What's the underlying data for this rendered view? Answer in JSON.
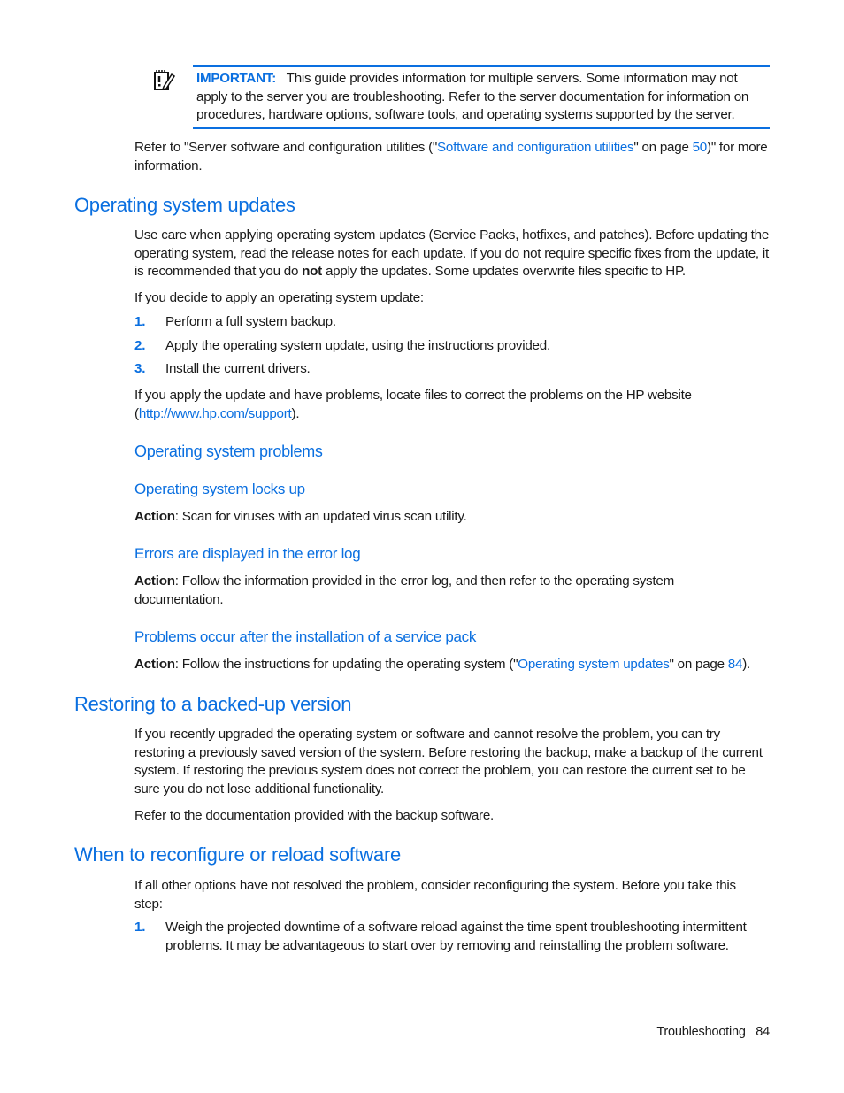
{
  "note": {
    "icon": "notepad-pencil-icon",
    "label": "IMPORTANT:",
    "text": "This guide provides information for multiple servers. Some information may not apply to the server you are troubleshooting. Refer to the server documentation for information on procedures, hardware options, software tools, and operating systems supported by the server."
  },
  "refer_para": {
    "pre": "Refer to \"Server software and configuration utilities (\"",
    "link": "Software and configuration utilities",
    "mid": "\" on page ",
    "page_link": "50",
    "post": ")\" for more information."
  },
  "section_os_updates": {
    "heading": "Operating system updates",
    "para1_pre": "Use care when applying operating system updates (Service Packs, hotfixes, and patches). Before updating the operating system, read the release notes for each update. If you do not require specific fixes from the update, it is recommended that you do ",
    "para1_bold": "not",
    "para1_post": " apply the updates. Some updates overwrite files specific to HP.",
    "para2": "If you decide to apply an operating system update:",
    "steps": [
      {
        "num": "1.",
        "text": "Perform a full system backup."
      },
      {
        "num": "2.",
        "text": "Apply the operating system update, using the instructions provided."
      },
      {
        "num": "3.",
        "text": "Install the current drivers."
      }
    ],
    "para3_pre": "If you apply the update and have problems, locate files to correct the problems on the HP website (",
    "para3_link": "http://www.hp.com/support",
    "para3_post": ")."
  },
  "section_os_problems": {
    "heading": "Operating system problems",
    "items": [
      {
        "heading": "Operating system locks up",
        "action_label": "Action",
        "action_text": ": Scan for viruses with an updated virus scan utility."
      },
      {
        "heading": "Errors are displayed in the error log",
        "action_label": "Action",
        "action_text": ": Follow the information provided in the error log, and then refer to the operating system documentation."
      },
      {
        "heading": "Problems occur after the installation of a service pack",
        "action_label": "Action",
        "action_pre": ": Follow the instructions for updating the operating system (\"",
        "action_link": "Operating system updates",
        "action_mid": "\" on page ",
        "action_page_link": "84",
        "action_post": ")."
      }
    ]
  },
  "section_restoring": {
    "heading": "Restoring to a backed-up version",
    "para1": "If you recently upgraded the operating system or software and cannot resolve the problem, you can try restoring a previously saved version of the system. Before restoring the backup, make a backup of the current system. If restoring the previous system does not correct the problem, you can restore the current set to be sure you do not lose additional functionality.",
    "para2": "Refer to the documentation provided with the backup software."
  },
  "section_reconfigure": {
    "heading": "When to reconfigure or reload software",
    "para1": "If all other options have not resolved the problem, consider reconfiguring the system. Before you take this step:",
    "steps": [
      {
        "num": "1.",
        "text": "Weigh the projected downtime of a software reload against the time spent troubleshooting intermittent problems. It may be advantageous to start over by removing and reinstalling the problem software."
      }
    ]
  },
  "footer": {
    "section": "Troubleshooting",
    "page": "84"
  },
  "colors": {
    "accent": "#0a6fe0",
    "text": "#1a1a1a"
  }
}
